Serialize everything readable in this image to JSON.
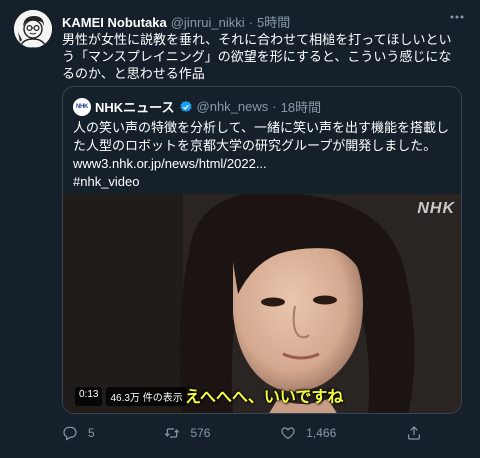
{
  "author": {
    "display_name": "KAMEI Nobutaka",
    "handle": "@jinrui_nikki",
    "dot": "·",
    "time": "5時間",
    "avatar": "avatar-icon"
  },
  "tweet": {
    "text": "男性が女性に説教を垂れ、それに合わせて相槌を打ってほしいという「マンスプレイニング」の欲望を形にすると、こういう感じになるのか、と思わせる作品"
  },
  "quote": {
    "logo_text": "NHK",
    "name": "NHKニュース",
    "handle": "@nhk_news",
    "dot": "·",
    "time": "18時間",
    "text": "人の笑い声の特徴を分析して、一緒に笑い声を出す機能を搭載した人型のロボットを京都大学の研究グループが開発しました。",
    "link": "www3.nhk.or.jp/news/html/2022...",
    "hashtag": "#nhk_video",
    "video": {
      "watermark": "NHK",
      "duration": "0:13",
      "views": "46.3万 件の表示",
      "subtitle": "えへへへ、いいですね"
    }
  },
  "actions": {
    "reply_count": "5",
    "retweet_count": "576",
    "like_count": "1,466"
  },
  "colors": {
    "background": "#15202b",
    "border": "#38444d",
    "secondary_text": "#8899a6",
    "subtitle": "#f7ff3a",
    "verified": "#1da1f2"
  }
}
